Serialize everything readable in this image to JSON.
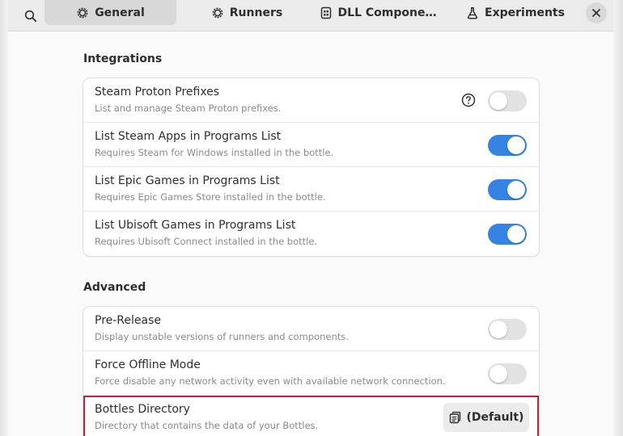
{
  "tabs": [
    {
      "label": "General",
      "icon": "gear-icon",
      "active": true
    },
    {
      "label": "Runners",
      "icon": "gear-icon",
      "active": false
    },
    {
      "label": "DLL Compone…",
      "icon": "component-icon",
      "active": false
    },
    {
      "label": "Experiments",
      "icon": "flask-icon",
      "active": false
    }
  ],
  "sections": {
    "integrations": {
      "title": "Integrations",
      "rows": [
        {
          "title": "Steam Proton Prefixes",
          "subtitle": "List and manage Steam Proton prefixes.",
          "enabled": false
        },
        {
          "title": "List Steam Apps in Programs List",
          "subtitle": "Requires Steam for Windows installed in the bottle.",
          "enabled": true
        },
        {
          "title": "List Epic Games in Programs List",
          "subtitle": "Requires Epic Games Store installed in the bottle.",
          "enabled": true
        },
        {
          "title": "List Ubisoft Games in Programs List",
          "subtitle": "Requires Ubisoft Connect installed in the bottle.",
          "enabled": true
        }
      ]
    },
    "advanced": {
      "title": "Advanced",
      "rows": [
        {
          "title": "Pre-Release",
          "subtitle": "Display unstable versions of runners and components.",
          "enabled": false
        },
        {
          "title": "Force Offline Mode",
          "subtitle": "Force disable any network activity even with available network connection.",
          "enabled": false
        },
        {
          "title": "Bottles Directory",
          "subtitle": "Directory that contains the data of your Bottles.",
          "button_label": "(Default)"
        }
      ]
    }
  },
  "colors": {
    "accent": "#3584e4",
    "highlight": "#c8203f"
  }
}
